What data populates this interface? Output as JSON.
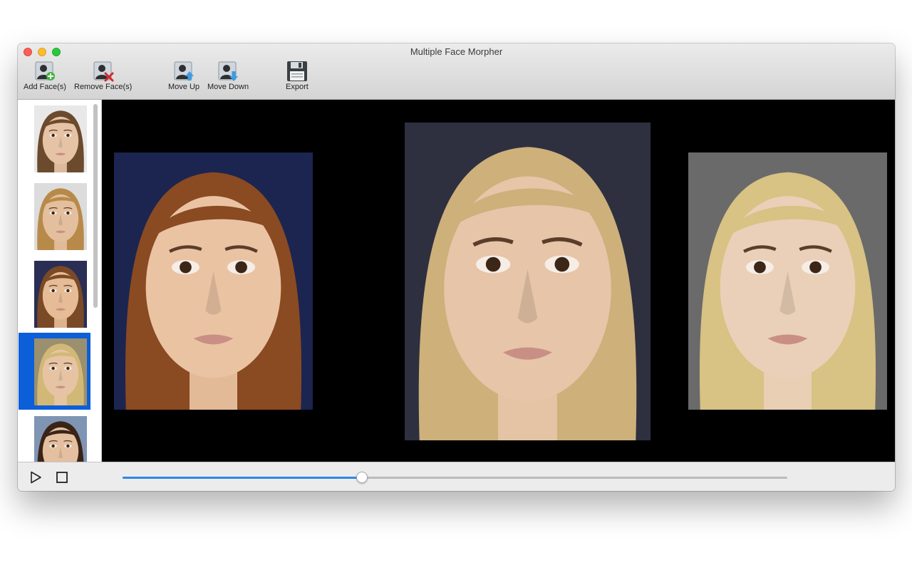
{
  "window": {
    "title": "Multiple Face Morpher"
  },
  "toolbar": {
    "add_label": "Add Face(s)",
    "remove_label": "Remove Face(s)",
    "move_up_label": "Move Up",
    "move_down_label": "Move Down",
    "export_label": "Export"
  },
  "sidebar": {
    "selected_index": 3,
    "thumbnails": [
      {
        "hair": "#6b4a2e",
        "skin": "#e7c3a6",
        "bg": "#e8e8e8"
      },
      {
        "hair": "#b88a4a",
        "skin": "#e4bf9e",
        "bg": "#dcdcdc"
      },
      {
        "hair": "#7a4a26",
        "skin": "#e5bc96",
        "bg": "#2a2e55"
      },
      {
        "hair": "#d2b877",
        "skin": "#e6c4a3",
        "bg": "#9a8f6e"
      },
      {
        "hair": "#3a2418",
        "skin": "#e4c0a0",
        "bg": "#7f95b3"
      }
    ]
  },
  "stage": {
    "left_face": {
      "hair": "#8a4a22",
      "skin": "#eac3a3",
      "bg": "#1c2550"
    },
    "center_face": {
      "hair": "#cdb07a",
      "skin": "#e6c5a8",
      "bg": "#2e3040"
    },
    "right_face": {
      "hair": "#d8c284",
      "skin": "#ead0b8",
      "bg": "#6a6a6a"
    }
  },
  "playback": {
    "progress": 0.36
  },
  "colors": {
    "accent": "#2f87e6",
    "selection": "#0b5fd8"
  },
  "icons": {
    "add": "add-face-icon",
    "remove": "remove-face-icon",
    "move_up": "move-up-icon",
    "move_down": "move-down-icon",
    "export": "floppy-disk-icon",
    "play": "play-icon",
    "stop": "stop-icon"
  }
}
